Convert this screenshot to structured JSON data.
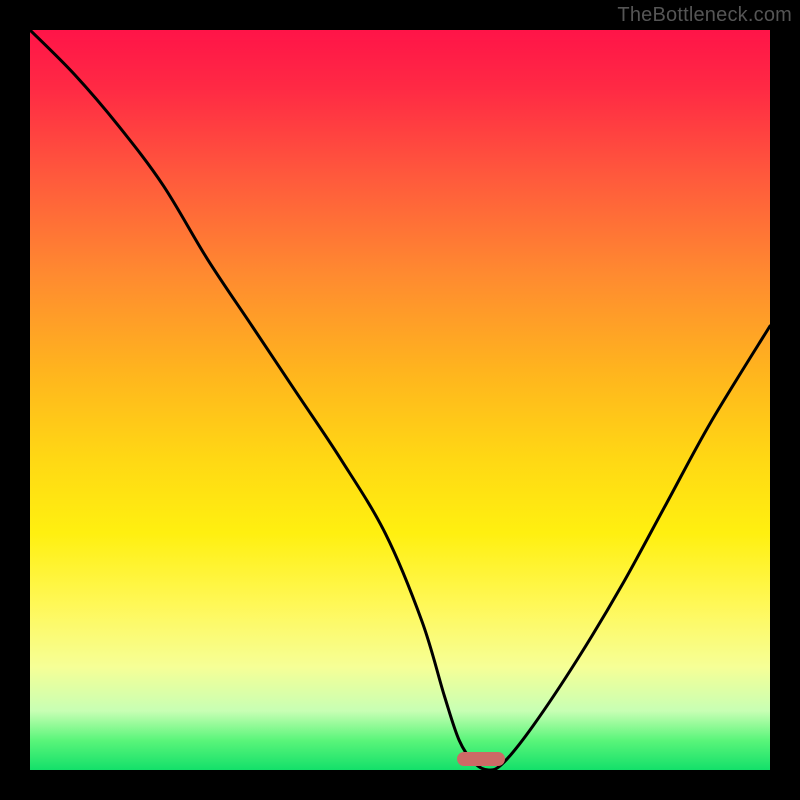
{
  "watermark": "TheBottleneck.com",
  "colors": {
    "frame": "#000000",
    "curve": "#000000",
    "marker": "#cc6a66",
    "gradient_stops": [
      "#ff1448",
      "#ff2a44",
      "#ff5a3c",
      "#ff8a30",
      "#ffb41e",
      "#ffd814",
      "#fff010",
      "#fff85a",
      "#f6ff96",
      "#c8ffb4",
      "#5af57a",
      "#13e06a"
    ]
  },
  "chart_data": {
    "type": "line",
    "title": "",
    "xlabel": "",
    "ylabel": "",
    "xlim": [
      0,
      100
    ],
    "ylim": [
      0,
      100
    ],
    "grid": false,
    "legend": false,
    "series": [
      {
        "name": "bottleneck-curve",
        "x": [
          0,
          6,
          12,
          18,
          24,
          30,
          36,
          42,
          48,
          53,
          56,
          58,
          60,
          62,
          64,
          68,
          74,
          80,
          86,
          92,
          100
        ],
        "y": [
          100,
          94,
          87,
          79,
          69,
          60,
          51,
          42,
          32,
          20,
          10,
          4,
          1,
          0,
          1,
          6,
          15,
          25,
          36,
          47,
          60
        ]
      }
    ],
    "marker": {
      "x": 61,
      "y": 1.5,
      "shape": "pill"
    },
    "note": "x/y are percentages of the plot area; y is distance from the bottom (0 = bottom green band, 100 = top red). Values read off the image by eye — no numeric axes are present."
  }
}
